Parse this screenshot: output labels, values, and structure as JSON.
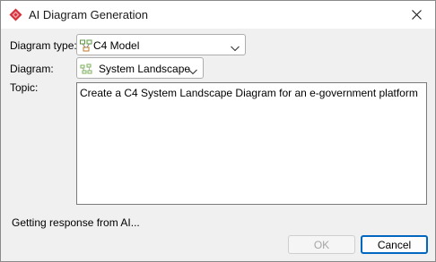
{
  "window": {
    "title": "AI Diagram Generation",
    "colors": {
      "accent": "#0067c0",
      "app_icon": "#d6303a"
    }
  },
  "form": {
    "diagram_type_label": "Diagram type:",
    "diagram_type_value": "C4 Model",
    "diagram_label": "Diagram:",
    "diagram_value": "System Landscape",
    "topic_label": "Topic:",
    "topic_value": "Create a C4 System Landscape Diagram for an e-government platform"
  },
  "status": {
    "text": "Getting response from AI..."
  },
  "buttons": {
    "ok": "OK",
    "cancel": "Cancel"
  }
}
